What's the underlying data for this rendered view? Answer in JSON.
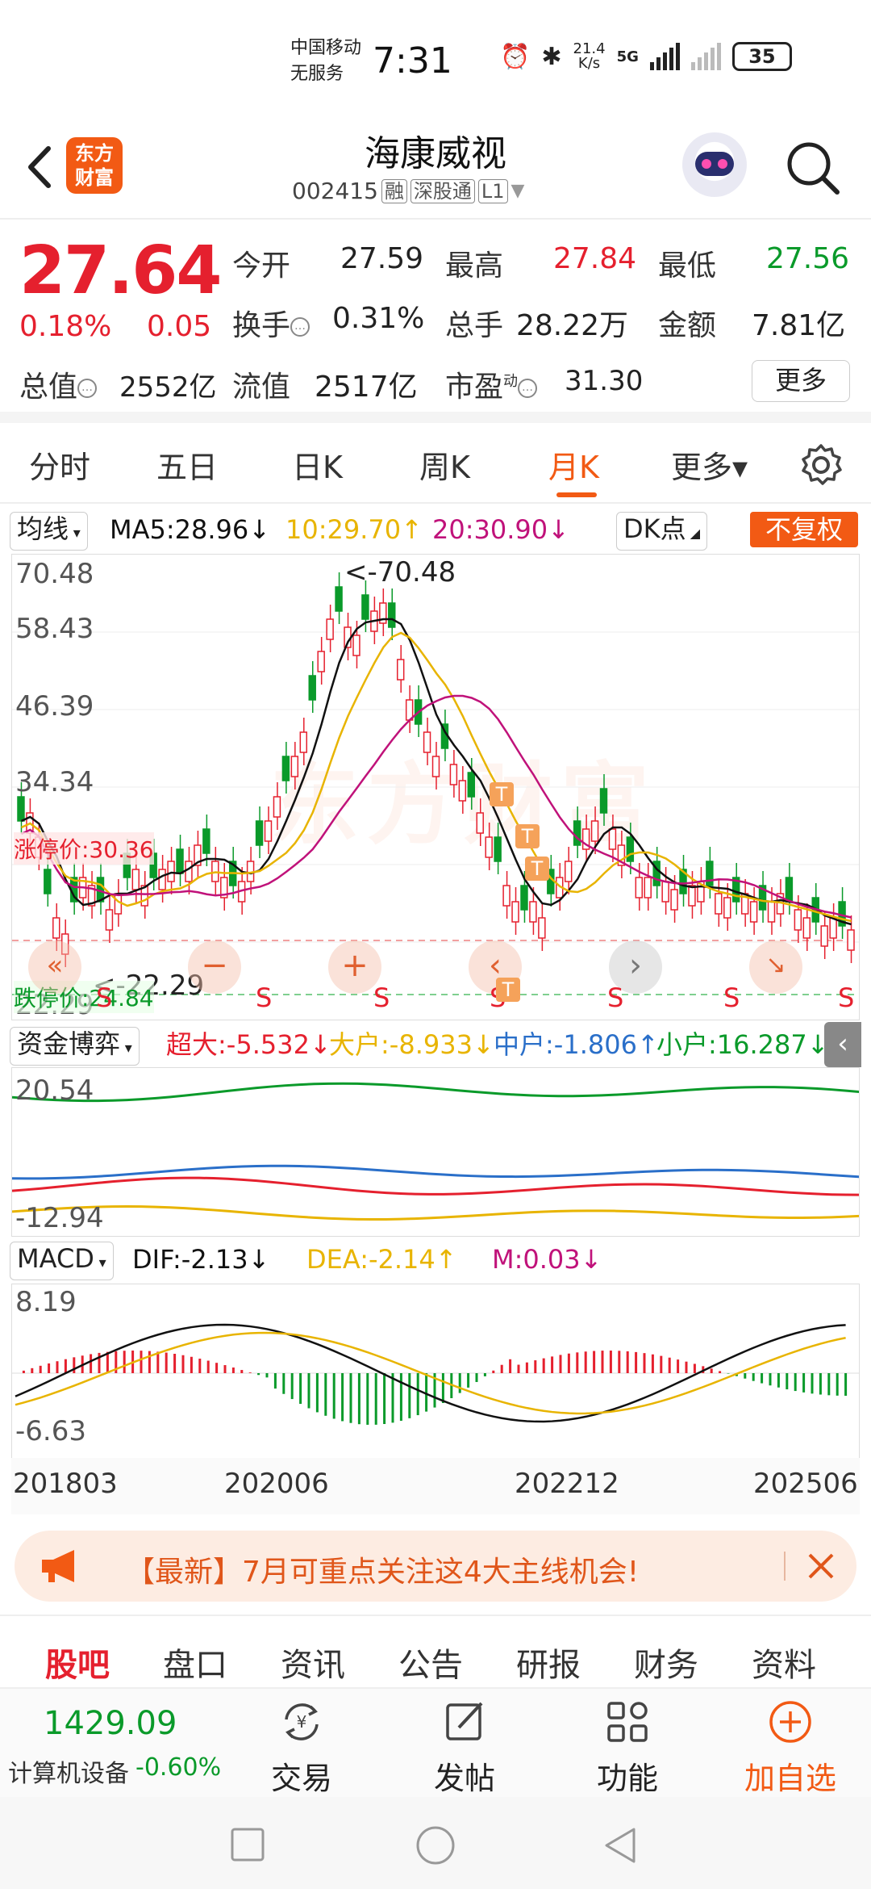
{
  "status_bar": {
    "carrier_line1": "中国移动",
    "carrier_line2": "无服务",
    "time": "7:31",
    "speed_value": "21.4",
    "speed_unit": "K/s",
    "network": "5G",
    "battery": "35"
  },
  "header": {
    "logo_line1": "东方",
    "logo_line2": "财富",
    "stock_name": "海康威视",
    "stock_code": "002415",
    "tags": [
      "融",
      "深股通",
      "L1"
    ]
  },
  "quote": {
    "price": "27.64",
    "change_pct": "0.18%",
    "change_abs": "0.05",
    "open_label": "今开",
    "open_value": "27.59",
    "high_label": "最高",
    "high_value": "27.84",
    "low_label": "最低",
    "low_value": "27.56",
    "turnover_label": "换手",
    "turnover_value": "0.31%",
    "volume_label": "总手",
    "volume_value": "28.22万",
    "amount_label": "金额",
    "amount_value": "7.81亿",
    "mcap_label": "总值",
    "mcap_value": "2552亿",
    "float_label": "流值",
    "float_value": "2517亿",
    "pe_label": "市盈",
    "pe_sup": "动",
    "pe_value": "31.30",
    "more_label": "更多"
  },
  "period_tabs": [
    {
      "label": "分时"
    },
    {
      "label": "五日"
    },
    {
      "label": "日K"
    },
    {
      "label": "周K"
    },
    {
      "label": "月K",
      "active": true
    },
    {
      "label": "更多▾"
    }
  ],
  "ma_bar": {
    "selector": "均线",
    "ma5": "MA5:28.96↓",
    "ma10": "10:29.70↑",
    "ma20": "20:30.90↓",
    "dk": "DK点",
    "fuquan": "不复权"
  },
  "kline": {
    "axis_labels": [
      "70.48",
      "58.43",
      "46.39",
      "34.34",
      "22.29"
    ],
    "max_marker": "<-70.48",
    "min_marker": "<-22.29",
    "limit_up_label": "涨停价:30.36",
    "limit_down_label": "跌停价:24.84",
    "signal_s": "S",
    "signal_t": "T",
    "watermark": "东方财富"
  },
  "fund_bar": {
    "selector": "资金博弈",
    "super": "超大:-5.532↓",
    "large": "大户:-8.933↓",
    "medium": "中户:-1.806↑",
    "small": "小户:16.287↓",
    "axis_top": "20.54",
    "axis_bottom": "-12.94"
  },
  "macd_bar": {
    "selector": "MACD",
    "dif": "DIF:-2.13↓",
    "dea": "DEA:-2.14↑",
    "m": "M:0.03↓",
    "axis_top": "8.19",
    "axis_bottom": "-6.63"
  },
  "date_axis": [
    "201803",
    "202006",
    "202212",
    "202506"
  ],
  "banner": {
    "text": "【最新】7月可重点关注这4大主线机会!"
  },
  "bottom_tabs": [
    {
      "label": "股吧",
      "active": true
    },
    {
      "label": "盘口"
    },
    {
      "label": "资讯"
    },
    {
      "label": "公告"
    },
    {
      "label": "研报"
    },
    {
      "label": "财务"
    },
    {
      "label": "资料"
    }
  ],
  "bottom_nav": {
    "index_value": "1429.09",
    "index_name": "计算机设备",
    "index_pct": "-0.60%",
    "trade": "交易",
    "post": "发帖",
    "function": "功能",
    "add": "加自选"
  },
  "colors": {
    "accent": "#f25a14",
    "up": "#e5202e",
    "down": "#0a9a2a",
    "ma5": "#111111",
    "ma10": "#e8b400",
    "ma20": "#c0127a"
  }
}
